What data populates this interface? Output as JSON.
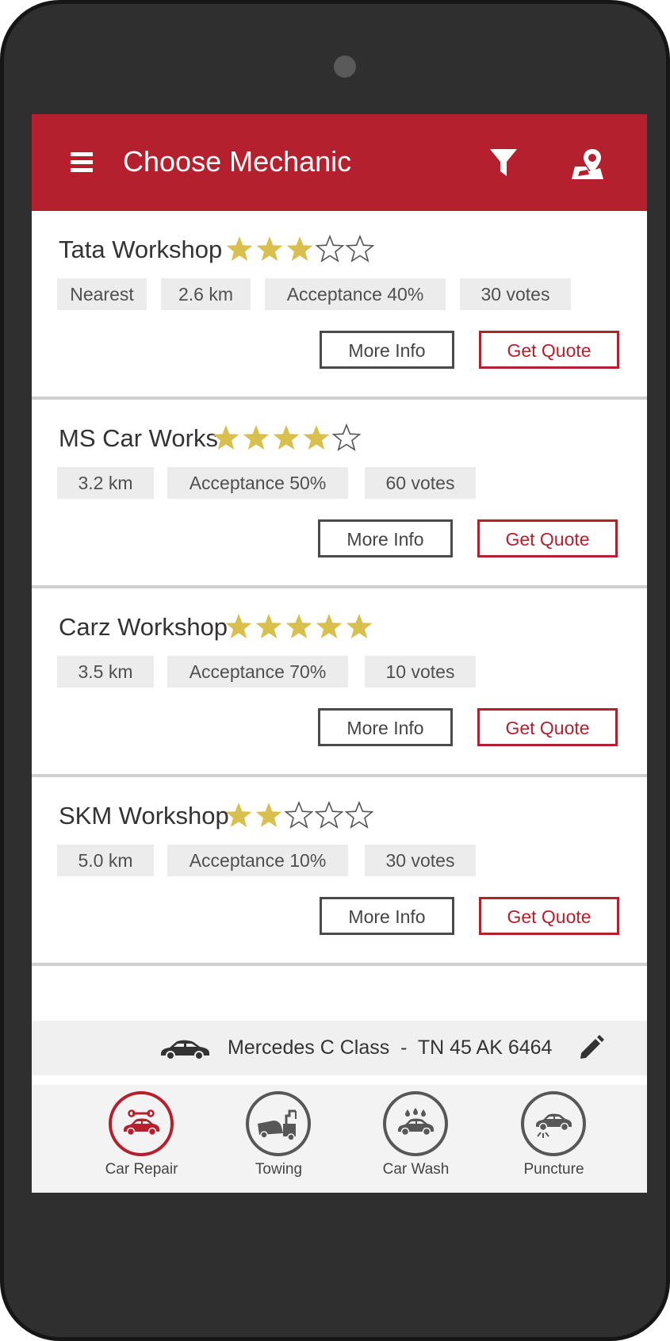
{
  "appbar": {
    "title": "Choose Mechanic",
    "color": "#b5202e",
    "icons": [
      "menu-icon",
      "filter-icon",
      "map-location-icon"
    ]
  },
  "mechanics": [
    {
      "name": "Tata Workshop",
      "rating": 3,
      "rating_max": 5,
      "tags": [
        "Nearest",
        "2.6 km",
        "Acceptance 40%",
        "30 votes"
      ],
      "more_info_label": "More Info",
      "get_quote_label": "Get Quote"
    },
    {
      "name": "MS Car Works",
      "rating": 4,
      "rating_max": 5,
      "tags": [
        "3.2 km",
        "Acceptance 50%",
        "60 votes"
      ],
      "more_info_label": "More Info",
      "get_quote_label": "Get Quote"
    },
    {
      "name": "Carz Workshop",
      "rating": 5,
      "rating_max": 5,
      "tags": [
        "3.5 km",
        "Acceptance 70%",
        "10 votes"
      ],
      "more_info_label": "More Info",
      "get_quote_label": "Get Quote"
    },
    {
      "name": "SKM Workshop",
      "rating": 2,
      "rating_max": 5,
      "tags": [
        "5.0 km",
        "Acceptance 10%",
        "30 votes"
      ],
      "more_info_label": "More Info",
      "get_quote_label": "Get Quote"
    }
  ],
  "vehicle": {
    "text": "Mercedes C Class  -  TN 45 AK 6464",
    "icons": [
      "car-icon",
      "edit-icon"
    ]
  },
  "bottom_nav": [
    {
      "label": "Car Repair",
      "icon": "car-repair-icon",
      "active": true
    },
    {
      "label": "Towing",
      "icon": "towing-icon",
      "active": false
    },
    {
      "label": "Car Wash",
      "icon": "car-wash-icon",
      "active": false
    },
    {
      "label": "Puncture",
      "icon": "puncture-icon",
      "active": false
    }
  ],
  "colors": {
    "accent": "#b5202e",
    "star_filled": "#d9bf4e",
    "star_empty": "#555555",
    "tag_bg": "#ececec"
  }
}
